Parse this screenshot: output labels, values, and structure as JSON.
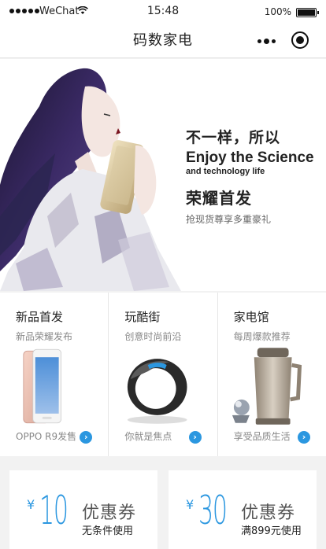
{
  "status_bar": {
    "carrier": "WeChat",
    "time": "15:48",
    "battery": "100%"
  },
  "nav": {
    "title": "码数家电"
  },
  "banner": {
    "headline": "不一样，所以",
    "english_main": "Enjoy the Science",
    "english_sub": "and technology life",
    "cn_title": "荣耀首发",
    "subtitle": "抢现货尊享多重豪礼"
  },
  "categories": [
    {
      "title": "新品首发",
      "subtitle": "新品荣耀发布",
      "footer": "OPPO R9发售",
      "icon": "phone"
    },
    {
      "title": "玩酷街",
      "subtitle": "创意时尚前沿",
      "footer": "你就是焦点",
      "icon": "smart-ring"
    },
    {
      "title": "家电馆",
      "subtitle": "每周爆款推荐",
      "footer": "享受品质生活",
      "icon": "soymilk-maker"
    }
  ],
  "coupons": [
    {
      "symbol": "¥",
      "amount": "10",
      "label": "优惠券",
      "condition": "无条件使用"
    },
    {
      "symbol": "¥",
      "amount": "30",
      "label": "优惠券",
      "condition": "满899元使用"
    }
  ],
  "colors": {
    "accent": "#2b97e0",
    "background": "#f2f2f2"
  }
}
